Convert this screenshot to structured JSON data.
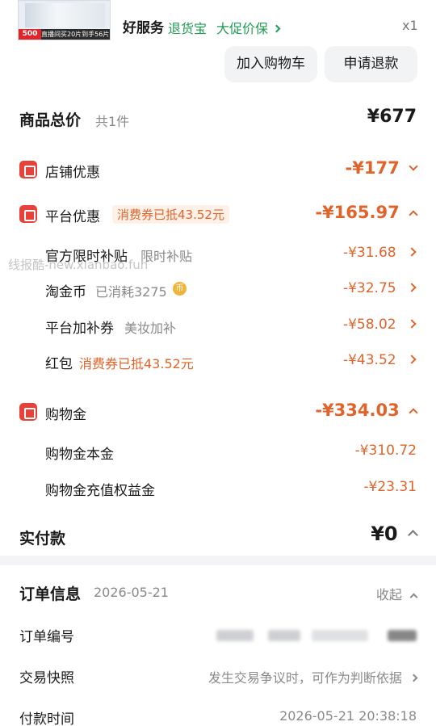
{
  "product": {
    "thumb_badge": "500",
    "thumb_promo": "直播间买20片到手56片",
    "service_logo": "好服务",
    "service_tags": [
      "退货宝",
      "大促价保"
    ],
    "quantity": "x1",
    "buttons": [
      "加入购物车",
      "申请退款"
    ]
  },
  "summary": {
    "total_label": "商品总价",
    "total_count": "共1件",
    "total_value": "¥677"
  },
  "store_discount": {
    "label": "店铺优惠",
    "value": "-¥177"
  },
  "platform_discount": {
    "label": "平台优惠",
    "pill": "消费券已抵43.52元",
    "value": "-¥165.97",
    "items": [
      {
        "label": "官方限时补贴",
        "sub": "限时补贴",
        "value": "-¥31.68"
      },
      {
        "label": "淘金币",
        "sub": "已消耗3275",
        "coin": "币",
        "value": "-¥32.75"
      },
      {
        "label": "平台加补券",
        "sub": "美妆加补",
        "value": "-¥58.02"
      },
      {
        "label": "红包",
        "sub": "消费券已抵43.52元",
        "value": "-¥43.52"
      }
    ]
  },
  "shopping_gold": {
    "label": "购物金",
    "value": "-¥334.03",
    "items": [
      {
        "label": "购物金本金",
        "value": "-¥310.72"
      },
      {
        "label": "购物金充值权益金",
        "value": "-¥23.31"
      }
    ]
  },
  "paid": {
    "label": "实付款",
    "value": "¥0"
  },
  "order_info": {
    "title": "订单信息",
    "date": "2026-05-21",
    "collapse": "收起",
    "order_no_label": "订单编号",
    "snapshot_label": "交易快照",
    "snapshot_value": "发生交易争议时，可作为判断依据",
    "pay_time_label": "付款时间",
    "pay_time_value": "2026-05-21 20:38:18"
  },
  "watermark": "线报酷-new.xianbao.fun",
  "colors": {
    "accent_orange": "#e0642a",
    "icon_red": "#e8413a",
    "service_green": "#1f9d55"
  }
}
